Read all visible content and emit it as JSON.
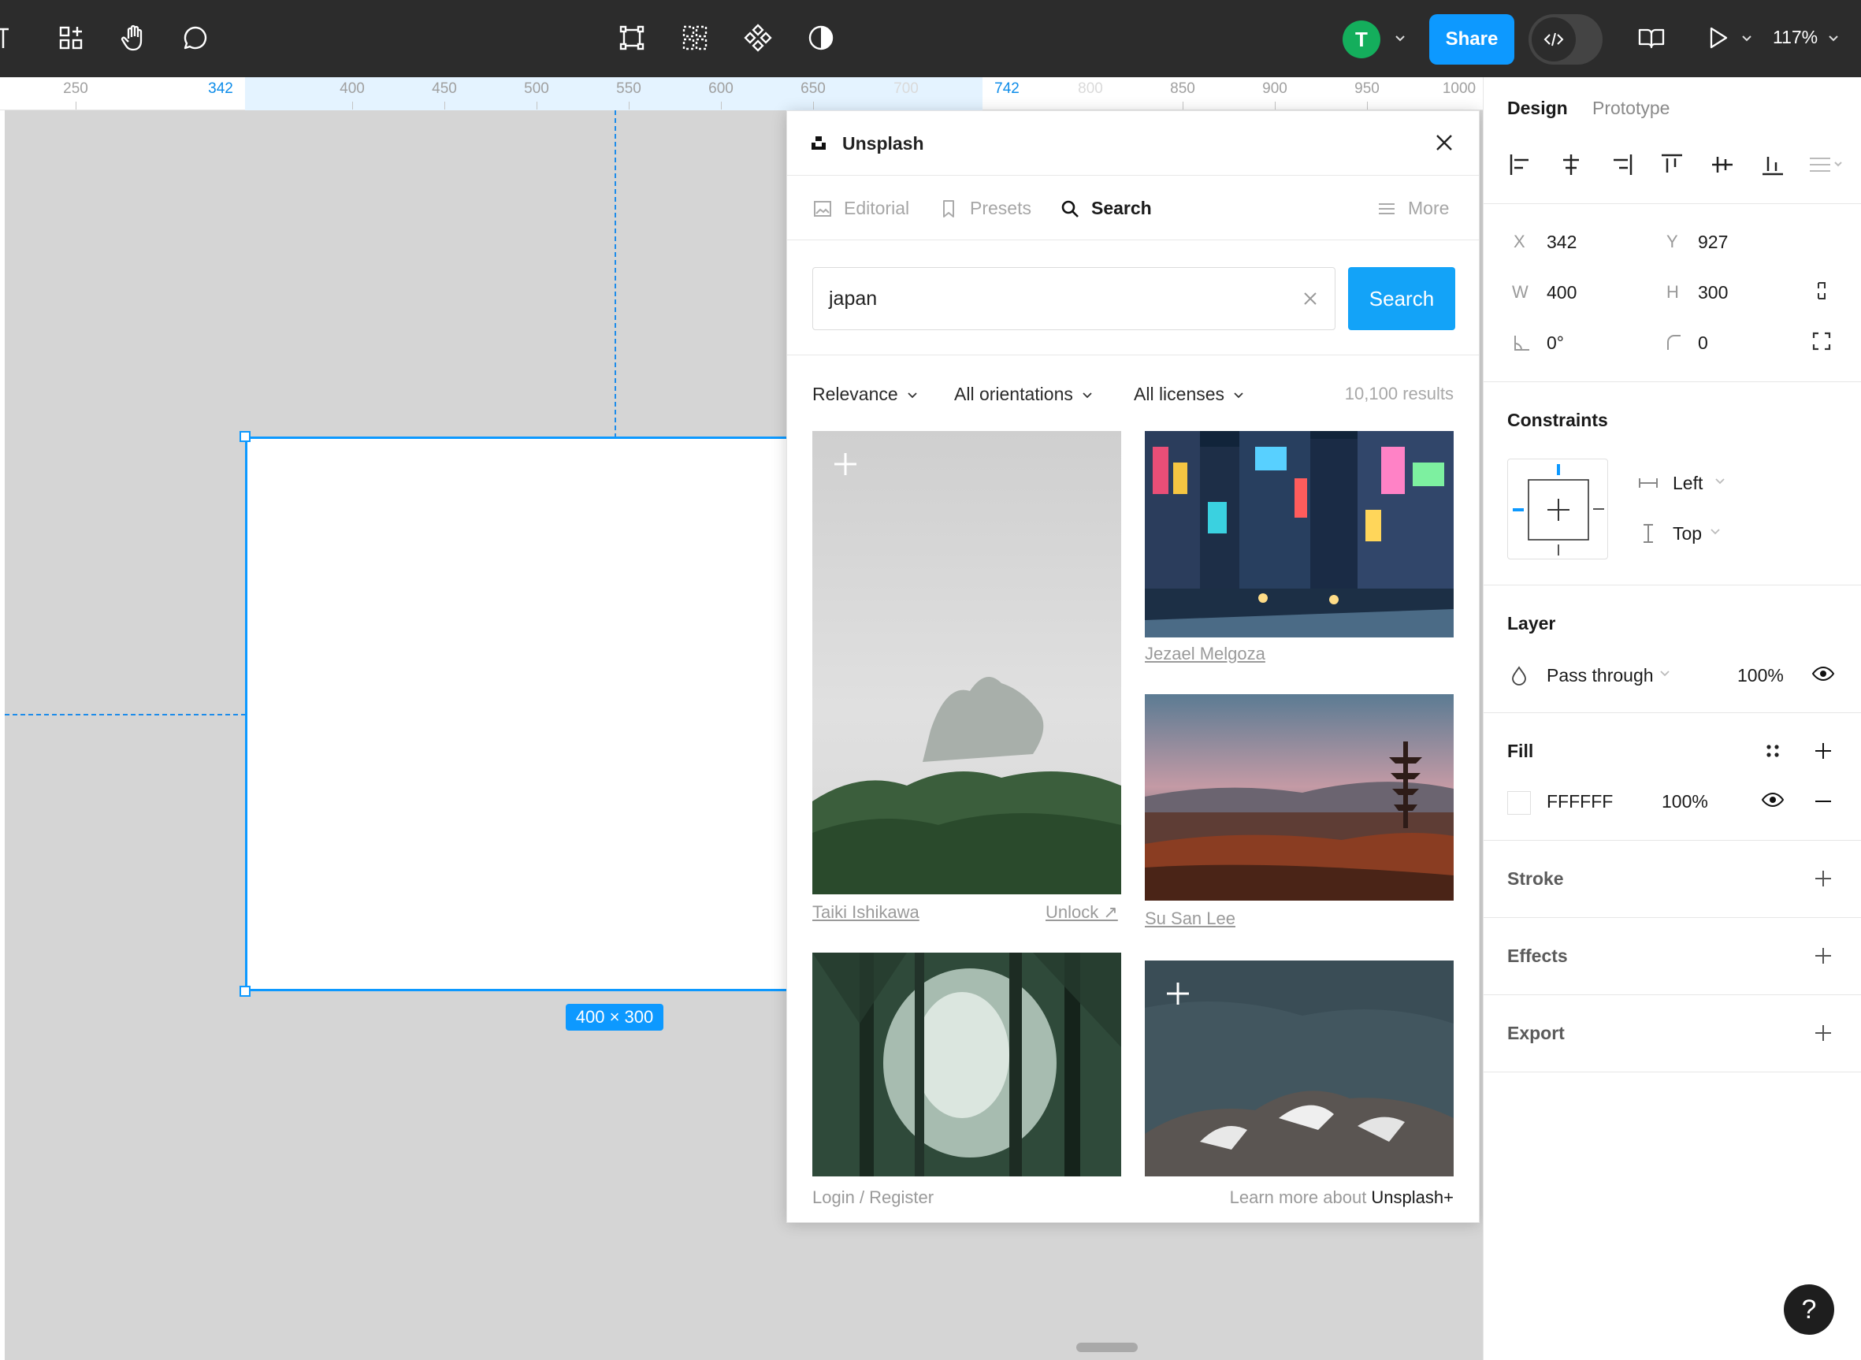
{
  "toolbar": {
    "avatar_initial": "T",
    "share_label": "Share",
    "zoom": "117%"
  },
  "ruler": {
    "ticks": [
      "250",
      "342",
      "400",
      "450",
      "500",
      "550",
      "600",
      "650",
      "700",
      "742",
      "800",
      "850",
      "900",
      "950",
      "1000"
    ]
  },
  "canvas": {
    "size_badge": "400 × 300"
  },
  "plugin": {
    "title": "Unsplash",
    "tabs": [
      {
        "label": "Editorial",
        "icon": "image-icon"
      },
      {
        "label": "Presets",
        "icon": "bookmark-icon"
      },
      {
        "label": "Search",
        "icon": "search-icon"
      },
      {
        "label": "More",
        "icon": "menu-icon"
      }
    ],
    "search_value": "japan",
    "search_button": "Search",
    "filters": [
      "Relevance",
      "All orientations",
      "All licenses"
    ],
    "results": "10,100 results",
    "photos": [
      {
        "credit": "Taiki Ishikawa",
        "unlock": "Unlock ↗",
        "premium": true
      },
      {
        "credit": "Jezael Melgoza",
        "premium": false
      },
      {
        "credit": "Su San Lee",
        "premium": false
      },
      {
        "credit": "",
        "premium": false
      },
      {
        "credit": "",
        "premium": true
      }
    ],
    "footer_left": "Login / Register",
    "footer_right_prefix": "Learn more about ",
    "footer_right_brand": "Unsplash+"
  },
  "panel": {
    "tabs": [
      "Design",
      "Prototype"
    ],
    "x_label": "X",
    "x": "342",
    "y_label": "Y",
    "y": "927",
    "w_label": "W",
    "w": "400",
    "h_label": "H",
    "h": "300",
    "rotation": "0°",
    "radius": "0",
    "constraints_title": "Constraints",
    "constraint_h": "Left",
    "constraint_v": "Top",
    "layer_title": "Layer",
    "blend": "Pass through",
    "layer_opacity": "100%",
    "fill_title": "Fill",
    "fill_hex": "FFFFFF",
    "fill_opacity": "100%",
    "stroke_title": "Stroke",
    "effects_title": "Effects",
    "export_title": "Export",
    "help": "?"
  },
  "colors": {
    "accent": "#0d99ff",
    "toolbar_bg": "#2c2c2c",
    "avatar": "#14ae5c",
    "canvas_bg": "#d5d5d5"
  }
}
